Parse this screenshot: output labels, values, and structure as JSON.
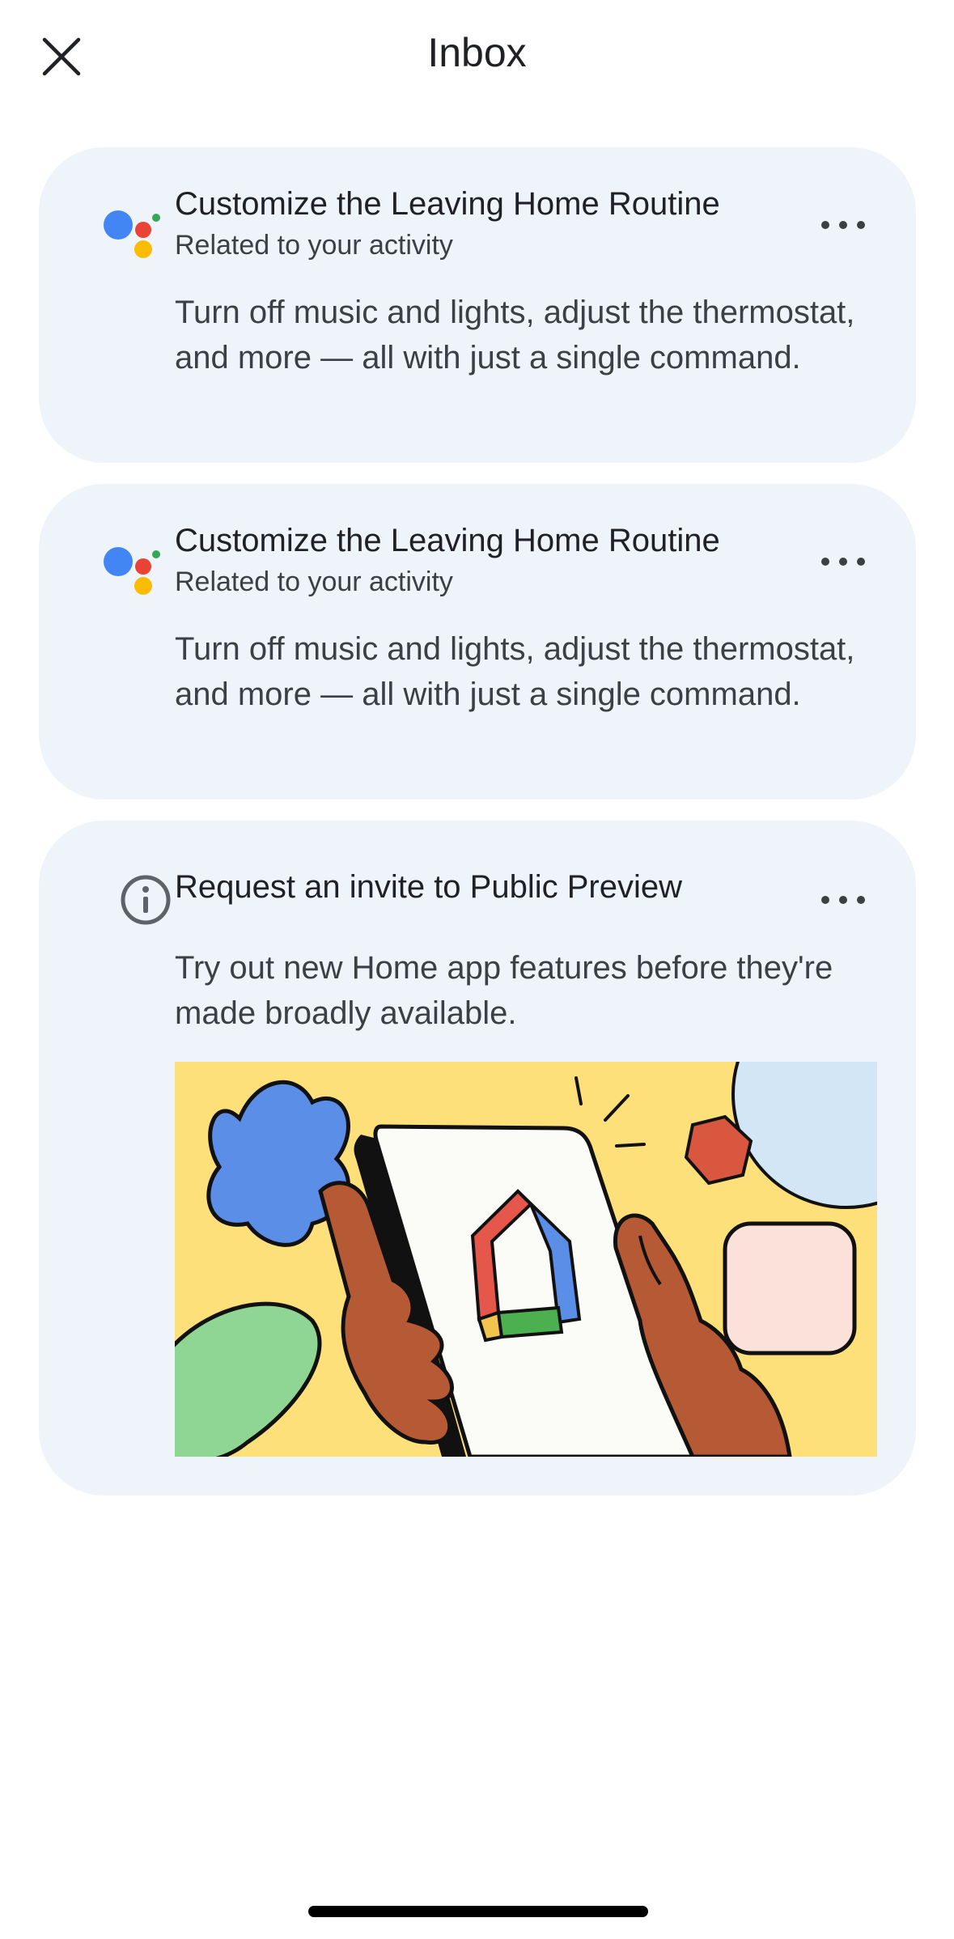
{
  "header": {
    "title": "Inbox"
  },
  "cards": [
    {
      "icon": "google-assistant-icon",
      "title": "Customize the Leaving Home Routine",
      "subtitle": "Related to your activity",
      "body": "Turn off music and lights, adjust the thermostat, and more — all with just a single command."
    },
    {
      "icon": "google-assistant-icon",
      "title": "Customize the Leaving Home Routine",
      "subtitle": "Related to your activity",
      "body": "Turn off music and lights, adjust the thermostat, and more — all with just a single command."
    },
    {
      "icon": "info-icon",
      "title": "Request an invite to Public Preview",
      "body": "Try out new Home app features before they're made broadly available.",
      "illustration": "hand-holding-phone-with-google-home-logo"
    }
  ],
  "colors": {
    "card_background": "#eff4fa",
    "google_blue": "#4285f4",
    "google_red": "#ea4335",
    "google_yellow": "#fbbc04",
    "google_green": "#34a853",
    "illustration_background": "#fde07a"
  }
}
